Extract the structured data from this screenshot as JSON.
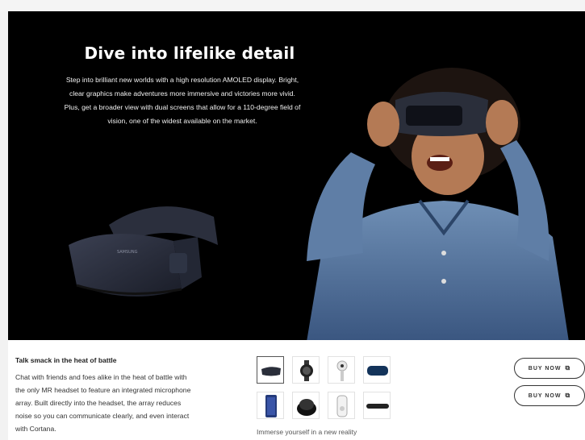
{
  "hero": {
    "title": "Dive into lifelike detail",
    "body": "Step into brilliant new worlds with a high resolution AMOLED display. Bright, clear graphics make adventures more immersive and victories more vivid. Plus, get a broader view with dual screens that allow for a 110-degree field of vision, one of the widest available on the market.",
    "headset_brand": "SAMSUNG"
  },
  "feature": {
    "title": "Talk smack in the heat of battle",
    "body": "Chat with friends and foes alike in the heat of battle with the only MR headset to feature an integrated microphone array. Built directly into the headset, the array reduces noise so you can communicate clearly, and even interact with Cortana."
  },
  "gallery": {
    "thumbnails": [
      {
        "name": "gear-vr-headset"
      },
      {
        "name": "smartwatch"
      },
      {
        "name": "360-camera"
      },
      {
        "name": "blue-case"
      },
      {
        "name": "phone-blue"
      },
      {
        "name": "wireless-charger"
      },
      {
        "name": "white-speaker"
      },
      {
        "name": "sound-bar"
      }
    ],
    "caption": "Immerse yourself in a new reality"
  },
  "actions": {
    "buy_now_1": "BUY NOW",
    "buy_now_2": "BUY NOW",
    "external_icon": "external-link-icon"
  },
  "colors": {
    "hero_bg": "#000000",
    "selected_border": "#555555",
    "button_border": "#333333"
  }
}
